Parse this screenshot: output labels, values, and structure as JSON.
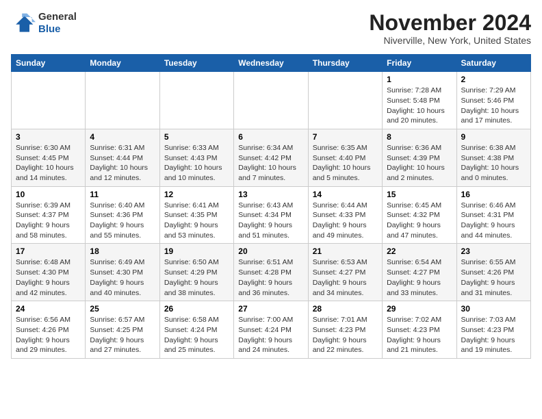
{
  "header": {
    "logo_line1": "General",
    "logo_line2": "Blue",
    "month": "November 2024",
    "location": "Niverville, New York, United States"
  },
  "days_of_week": [
    "Sunday",
    "Monday",
    "Tuesday",
    "Wednesday",
    "Thursday",
    "Friday",
    "Saturday"
  ],
  "weeks": [
    [
      {
        "num": "",
        "info": ""
      },
      {
        "num": "",
        "info": ""
      },
      {
        "num": "",
        "info": ""
      },
      {
        "num": "",
        "info": ""
      },
      {
        "num": "",
        "info": ""
      },
      {
        "num": "1",
        "info": "Sunrise: 7:28 AM\nSunset: 5:48 PM\nDaylight: 10 hours and 20 minutes."
      },
      {
        "num": "2",
        "info": "Sunrise: 7:29 AM\nSunset: 5:46 PM\nDaylight: 10 hours and 17 minutes."
      }
    ],
    [
      {
        "num": "3",
        "info": "Sunrise: 6:30 AM\nSunset: 4:45 PM\nDaylight: 10 hours and 14 minutes."
      },
      {
        "num": "4",
        "info": "Sunrise: 6:31 AM\nSunset: 4:44 PM\nDaylight: 10 hours and 12 minutes."
      },
      {
        "num": "5",
        "info": "Sunrise: 6:33 AM\nSunset: 4:43 PM\nDaylight: 10 hours and 10 minutes."
      },
      {
        "num": "6",
        "info": "Sunrise: 6:34 AM\nSunset: 4:42 PM\nDaylight: 10 hours and 7 minutes."
      },
      {
        "num": "7",
        "info": "Sunrise: 6:35 AM\nSunset: 4:40 PM\nDaylight: 10 hours and 5 minutes."
      },
      {
        "num": "8",
        "info": "Sunrise: 6:36 AM\nSunset: 4:39 PM\nDaylight: 10 hours and 2 minutes."
      },
      {
        "num": "9",
        "info": "Sunrise: 6:38 AM\nSunset: 4:38 PM\nDaylight: 10 hours and 0 minutes."
      }
    ],
    [
      {
        "num": "10",
        "info": "Sunrise: 6:39 AM\nSunset: 4:37 PM\nDaylight: 9 hours and 58 minutes."
      },
      {
        "num": "11",
        "info": "Sunrise: 6:40 AM\nSunset: 4:36 PM\nDaylight: 9 hours and 55 minutes."
      },
      {
        "num": "12",
        "info": "Sunrise: 6:41 AM\nSunset: 4:35 PM\nDaylight: 9 hours and 53 minutes."
      },
      {
        "num": "13",
        "info": "Sunrise: 6:43 AM\nSunset: 4:34 PM\nDaylight: 9 hours and 51 minutes."
      },
      {
        "num": "14",
        "info": "Sunrise: 6:44 AM\nSunset: 4:33 PM\nDaylight: 9 hours and 49 minutes."
      },
      {
        "num": "15",
        "info": "Sunrise: 6:45 AM\nSunset: 4:32 PM\nDaylight: 9 hours and 47 minutes."
      },
      {
        "num": "16",
        "info": "Sunrise: 6:46 AM\nSunset: 4:31 PM\nDaylight: 9 hours and 44 minutes."
      }
    ],
    [
      {
        "num": "17",
        "info": "Sunrise: 6:48 AM\nSunset: 4:30 PM\nDaylight: 9 hours and 42 minutes."
      },
      {
        "num": "18",
        "info": "Sunrise: 6:49 AM\nSunset: 4:30 PM\nDaylight: 9 hours and 40 minutes."
      },
      {
        "num": "19",
        "info": "Sunrise: 6:50 AM\nSunset: 4:29 PM\nDaylight: 9 hours and 38 minutes."
      },
      {
        "num": "20",
        "info": "Sunrise: 6:51 AM\nSunset: 4:28 PM\nDaylight: 9 hours and 36 minutes."
      },
      {
        "num": "21",
        "info": "Sunrise: 6:53 AM\nSunset: 4:27 PM\nDaylight: 9 hours and 34 minutes."
      },
      {
        "num": "22",
        "info": "Sunrise: 6:54 AM\nSunset: 4:27 PM\nDaylight: 9 hours and 33 minutes."
      },
      {
        "num": "23",
        "info": "Sunrise: 6:55 AM\nSunset: 4:26 PM\nDaylight: 9 hours and 31 minutes."
      }
    ],
    [
      {
        "num": "24",
        "info": "Sunrise: 6:56 AM\nSunset: 4:26 PM\nDaylight: 9 hours and 29 minutes."
      },
      {
        "num": "25",
        "info": "Sunrise: 6:57 AM\nSunset: 4:25 PM\nDaylight: 9 hours and 27 minutes."
      },
      {
        "num": "26",
        "info": "Sunrise: 6:58 AM\nSunset: 4:24 PM\nDaylight: 9 hours and 25 minutes."
      },
      {
        "num": "27",
        "info": "Sunrise: 7:00 AM\nSunset: 4:24 PM\nDaylight: 9 hours and 24 minutes."
      },
      {
        "num": "28",
        "info": "Sunrise: 7:01 AM\nSunset: 4:23 PM\nDaylight: 9 hours and 22 minutes."
      },
      {
        "num": "29",
        "info": "Sunrise: 7:02 AM\nSunset: 4:23 PM\nDaylight: 9 hours and 21 minutes."
      },
      {
        "num": "30",
        "info": "Sunrise: 7:03 AM\nSunset: 4:23 PM\nDaylight: 9 hours and 19 minutes."
      }
    ]
  ]
}
